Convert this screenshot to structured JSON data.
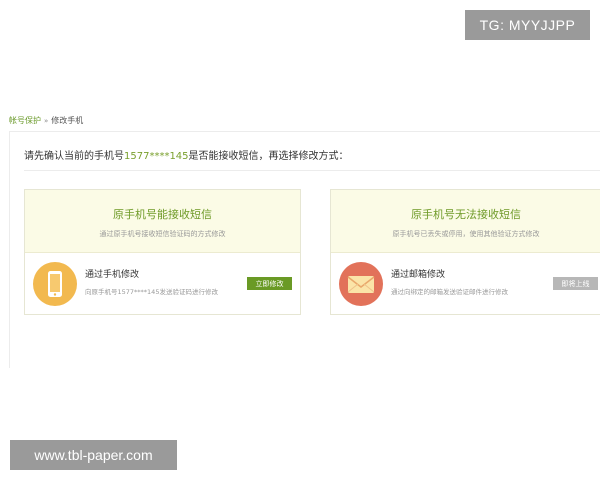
{
  "watermarks": {
    "top_right": "TG: MYYJJPP",
    "bottom_left": "www.tbl-paper.com"
  },
  "breadcrumb": {
    "parent": "帐号保护",
    "separator": "»",
    "current": "修改手机"
  },
  "confirm": {
    "prefix": "请先确认当前的手机号",
    "phone": "1577****145",
    "suffix": "是否能接收短信，再选择修改方式："
  },
  "cards": {
    "can_receive": {
      "title": "原手机号能接收短信",
      "subtitle": "通过原手机号接收短信验证码的方式修改",
      "method_title": "通过手机修改",
      "method_desc": "向原手机号1577****145发送验证码进行修改",
      "button_label": "立即修改",
      "icon": "mobile-phone-icon"
    },
    "cannot_receive": {
      "title": "原手机号无法接收短信",
      "subtitle": "原手机号已丢失或停用，使用其他验证方式修改",
      "method_title": "通过邮箱修改",
      "method_desc": "通过向绑定的邮箱发送验证邮件进行修改",
      "button_label": "即将上线",
      "icon": "envelope-icon"
    }
  },
  "colors": {
    "accent_green": "#6a9a25",
    "phone_icon_bg": "#f2b94f",
    "mail_icon_bg": "#e2725a",
    "card_header_bg": "#fbfbe6",
    "disabled_gray": "#b7b7b7"
  }
}
